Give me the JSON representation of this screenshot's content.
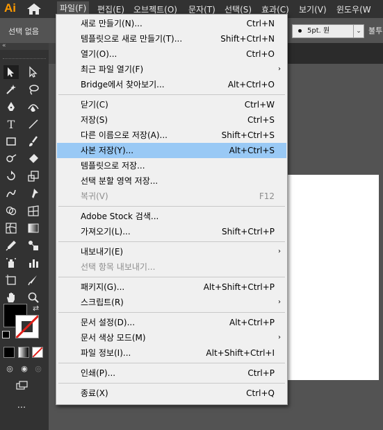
{
  "app": {
    "logo": "Ai"
  },
  "menubar": [
    {
      "id": "file",
      "label": "파일(F)"
    },
    {
      "id": "edit",
      "label": "편집(E)"
    },
    {
      "id": "object",
      "label": "오브젝트(O)"
    },
    {
      "id": "type",
      "label": "문자(T)"
    },
    {
      "id": "select",
      "label": "선택(S)"
    },
    {
      "id": "effect",
      "label": "효과(C)"
    },
    {
      "id": "view",
      "label": "보기(V)"
    },
    {
      "id": "window",
      "label": "윈도우(W"
    }
  ],
  "control": {
    "no_selection": "선택 없음",
    "stroke_weight": "5pt. 원",
    "opacity_label": "불투"
  },
  "file_menu": {
    "items": [
      {
        "label": "새로 만들기(N)...",
        "shortcut": "Ctrl+N"
      },
      {
        "label": "템플릿으로 새로 만들기(T)...",
        "shortcut": "Shift+Ctrl+N"
      },
      {
        "label": "열기(O)...",
        "shortcut": "Ctrl+O"
      },
      {
        "label": "최근 파일 열기(F)",
        "shortcut": "",
        "submenu": "›"
      },
      {
        "label": "Bridge에서 찾아보기...",
        "shortcut": "Alt+Ctrl+O"
      },
      {
        "label": "닫기(C)",
        "shortcut": "Ctrl+W"
      },
      {
        "label": "저장(S)",
        "shortcut": "Ctrl+S"
      },
      {
        "label": "다른 이름으로 저장(A)...",
        "shortcut": "Shift+Ctrl+S"
      },
      {
        "label": "사본 저장(Y)...",
        "shortcut": "Alt+Ctrl+S"
      },
      {
        "label": "템플릿으로 저장...",
        "shortcut": ""
      },
      {
        "label": "선택 분할 영역 저장...",
        "shortcut": ""
      },
      {
        "label": "복귀(V)",
        "shortcut": "F12"
      },
      {
        "label": "Adobe Stock 검색...",
        "shortcut": ""
      },
      {
        "label": "가져오기(L)...",
        "shortcut": "Shift+Ctrl+P"
      },
      {
        "label": "내보내기(E)",
        "shortcut": "",
        "submenu": "›"
      },
      {
        "label": "선택 항목 내보내기...",
        "shortcut": ""
      },
      {
        "label": "패키지(G)...",
        "shortcut": "Alt+Shift+Ctrl+P"
      },
      {
        "label": "스크립트(R)",
        "shortcut": "",
        "submenu": "›"
      },
      {
        "label": "문서 설정(D)...",
        "shortcut": "Alt+Ctrl+P"
      },
      {
        "label": "문서 색상 모드(M)",
        "shortcut": "",
        "submenu": "›"
      },
      {
        "label": "파일 정보(I)...",
        "shortcut": "Alt+Shift+Ctrl+I"
      },
      {
        "label": "인쇄(P)...",
        "shortcut": "Ctrl+P"
      },
      {
        "label": "종료(X)",
        "shortcut": "Ctrl+Q"
      }
    ]
  },
  "colors": {
    "highlight": "#99c9f5",
    "logo": "#ff9a00",
    "fill": "#000000",
    "stroke_none": "#e0201a"
  }
}
